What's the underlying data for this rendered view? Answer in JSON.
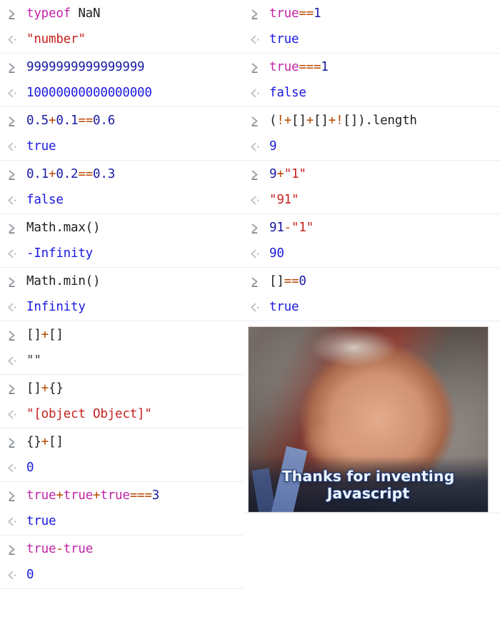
{
  "console": {
    "input_marker_icon": "chevron-right-prompt-icon",
    "output_marker_icon": "chevron-left-return-icon",
    "colors": {
      "keyword": "#c026a6",
      "operator": "#b84700",
      "number": "#1a1aa6",
      "string": "#c5221f",
      "plain": "#202124",
      "result_blue": "#1a1ae0",
      "result_string": "#c5221f",
      "marker_gray": "#9aa0a6",
      "divider": "#ececec",
      "caption": "#eef4ff"
    },
    "left_column": [
      {
        "input": "typeof NaN",
        "input_tokens": [
          {
            "text": "typeof",
            "kind": "keyword"
          },
          {
            "text": " NaN",
            "kind": "plain"
          }
        ],
        "output": "\"number\"",
        "output_kind": "string"
      },
      {
        "input": "9999999999999999",
        "input_tokens": [
          {
            "text": "9999999999999999",
            "kind": "number"
          }
        ],
        "output": "10000000000000000",
        "output_kind": "number"
      },
      {
        "input": "0.5+0.1==0.6",
        "input_tokens": [
          {
            "text": "0.5",
            "kind": "number"
          },
          {
            "text": "+",
            "kind": "operator"
          },
          {
            "text": "0.1",
            "kind": "number"
          },
          {
            "text": "==",
            "kind": "operator"
          },
          {
            "text": "0.6",
            "kind": "number"
          }
        ],
        "output": "true",
        "output_kind": "boolean"
      },
      {
        "input": "0.1+0.2==0.3",
        "input_tokens": [
          {
            "text": "0.1",
            "kind": "number"
          },
          {
            "text": "+",
            "kind": "operator"
          },
          {
            "text": "0.2",
            "kind": "number"
          },
          {
            "text": "==",
            "kind": "operator"
          },
          {
            "text": "0.3",
            "kind": "number"
          }
        ],
        "output": "false",
        "output_kind": "boolean"
      },
      {
        "input": "Math.max()",
        "input_tokens": [
          {
            "text": "Math.max()",
            "kind": "plain"
          }
        ],
        "output": "-Infinity",
        "output_kind": "number"
      },
      {
        "input": "Math.min()",
        "input_tokens": [
          {
            "text": "Math.min()",
            "kind": "plain"
          }
        ],
        "output": "Infinity",
        "output_kind": "number"
      },
      {
        "input": "[]+[]",
        "input_tokens": [
          {
            "text": "[]",
            "kind": "plain"
          },
          {
            "text": "+",
            "kind": "operator"
          },
          {
            "text": "[]",
            "kind": "plain"
          }
        ],
        "output": "\"\"",
        "output_kind": "empty-string"
      },
      {
        "input": "[]+{}",
        "input_tokens": [
          {
            "text": "[]",
            "kind": "plain"
          },
          {
            "text": "+",
            "kind": "operator"
          },
          {
            "text": "{}",
            "kind": "plain"
          }
        ],
        "output": "\"[object Object]\"",
        "output_kind": "string"
      },
      {
        "input": "{}+[]",
        "input_tokens": [
          {
            "text": "{}",
            "kind": "plain"
          },
          {
            "text": "+",
            "kind": "operator"
          },
          {
            "text": "[]",
            "kind": "plain"
          }
        ],
        "output": "0",
        "output_kind": "number"
      },
      {
        "input": "true+true+true===3",
        "input_tokens": [
          {
            "text": "true",
            "kind": "keyword"
          },
          {
            "text": "+",
            "kind": "operator"
          },
          {
            "text": "true",
            "kind": "keyword"
          },
          {
            "text": "+",
            "kind": "operator"
          },
          {
            "text": "true",
            "kind": "keyword"
          },
          {
            "text": "===",
            "kind": "operator"
          },
          {
            "text": "3",
            "kind": "number"
          }
        ],
        "output": "true",
        "output_kind": "boolean"
      },
      {
        "input": "true-true",
        "input_tokens": [
          {
            "text": "true",
            "kind": "keyword"
          },
          {
            "text": "-",
            "kind": "operator"
          },
          {
            "text": "true",
            "kind": "keyword"
          }
        ],
        "output": "0",
        "output_kind": "number"
      }
    ],
    "right_column": [
      {
        "input": "true==1",
        "input_tokens": [
          {
            "text": "true",
            "kind": "keyword"
          },
          {
            "text": "==",
            "kind": "operator"
          },
          {
            "text": "1",
            "kind": "number"
          }
        ],
        "output": "true",
        "output_kind": "boolean"
      },
      {
        "input": "true===1",
        "input_tokens": [
          {
            "text": "true",
            "kind": "keyword"
          },
          {
            "text": "===",
            "kind": "operator"
          },
          {
            "text": "1",
            "kind": "number"
          }
        ],
        "output": "false",
        "output_kind": "boolean"
      },
      {
        "input": "(!+[]+[]+![]).length",
        "input_tokens": [
          {
            "text": "(",
            "kind": "plain"
          },
          {
            "text": "!",
            "kind": "operator"
          },
          {
            "text": "+",
            "kind": "operator"
          },
          {
            "text": "[]",
            "kind": "plain"
          },
          {
            "text": "+",
            "kind": "operator"
          },
          {
            "text": "[]",
            "kind": "plain"
          },
          {
            "text": "+",
            "kind": "operator"
          },
          {
            "text": "!",
            "kind": "operator"
          },
          {
            "text": "[]).length",
            "kind": "plain"
          }
        ],
        "output": "9",
        "output_kind": "number"
      },
      {
        "input": "9+\"1\"",
        "input_tokens": [
          {
            "text": "9",
            "kind": "number"
          },
          {
            "text": "+",
            "kind": "operator"
          },
          {
            "text": "\"1\"",
            "kind": "string"
          }
        ],
        "output": "\"91\"",
        "output_kind": "string"
      },
      {
        "input": "91-\"1\"",
        "input_tokens": [
          {
            "text": "91",
            "kind": "number"
          },
          {
            "text": "-",
            "kind": "operator"
          },
          {
            "text": "\"1\"",
            "kind": "string"
          }
        ],
        "output": "90",
        "output_kind": "number"
      },
      {
        "input": "[]==0",
        "input_tokens": [
          {
            "text": "[]",
            "kind": "plain"
          },
          {
            "text": "==",
            "kind": "operator"
          },
          {
            "text": "0",
            "kind": "number"
          }
        ],
        "output": "true",
        "output_kind": "boolean"
      }
    ],
    "meme": {
      "alt": "Portrait of a smiling balding man wearing a dark suit and a blue conference lanyard",
      "caption": "Thanks for inventing Javascript"
    }
  }
}
